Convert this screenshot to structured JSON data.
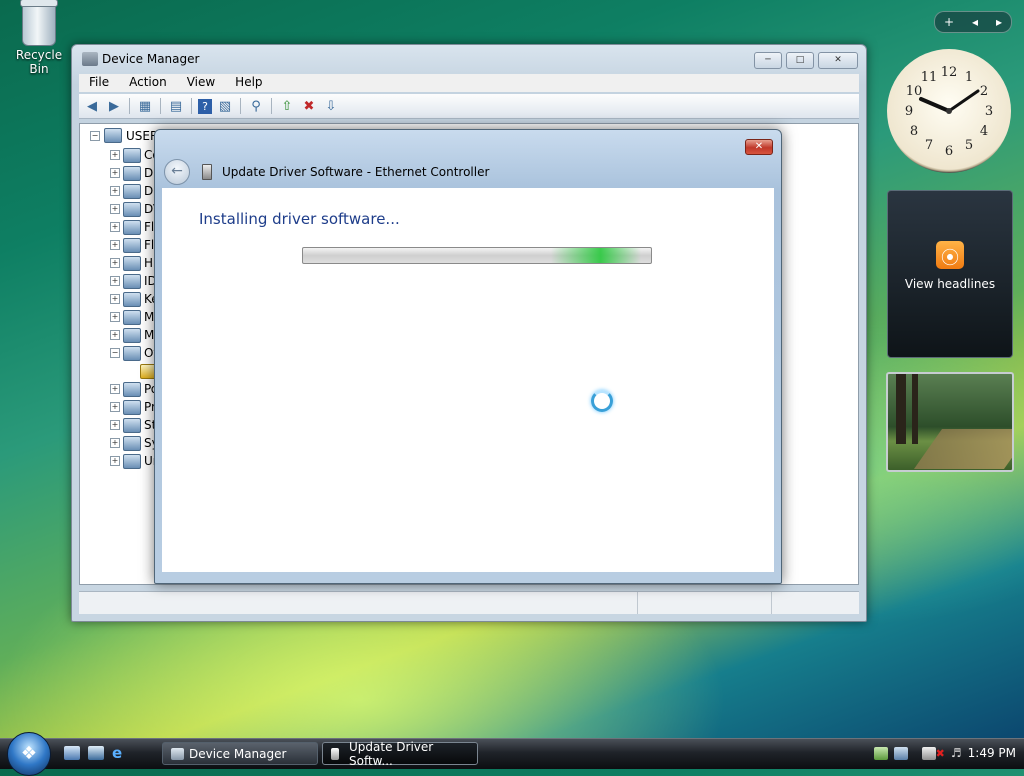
{
  "desktop": {
    "recycle_bin_label": "Recycle Bin"
  },
  "sidebar": {
    "top_controls": [
      "+",
      "◂",
      "▸"
    ],
    "clock_numbers": [
      "12",
      "1",
      "2",
      "3",
      "4",
      "5",
      "6",
      "7",
      "8",
      "9",
      "10",
      "11"
    ],
    "feed_label": "View headlines"
  },
  "device_manager": {
    "title": "Device Manager",
    "menu": [
      "File",
      "Action",
      "View",
      "Help"
    ],
    "toolbar_icons": [
      "back-icon",
      "forward-icon",
      "sep",
      "tree-view-icon",
      "sep",
      "properties-icon",
      "sep",
      "help-icon",
      "details-icon",
      "sep",
      "scan-hardware-icon",
      "sep",
      "update-driver-icon",
      "uninstall-icon",
      "disable-icon"
    ],
    "tree_root": "USER-",
    "tree_items": [
      "Co",
      "Di",
      "Di",
      "DV",
      "Fl",
      "Fl",
      "Hu",
      "ID",
      "Ke",
      "Mi",
      "Mo",
      "Ot",
      "",
      "Po",
      "Pr",
      "Sto",
      "Sy",
      "Un"
    ]
  },
  "update_driver": {
    "title": "Update Driver Software - Ethernet Controller",
    "heading": "Installing driver software...",
    "progress_indeterminate": true
  },
  "taskbar": {
    "buttons": [
      "Device Manager",
      "Update Driver Softw..."
    ],
    "time": "1:49 PM"
  }
}
